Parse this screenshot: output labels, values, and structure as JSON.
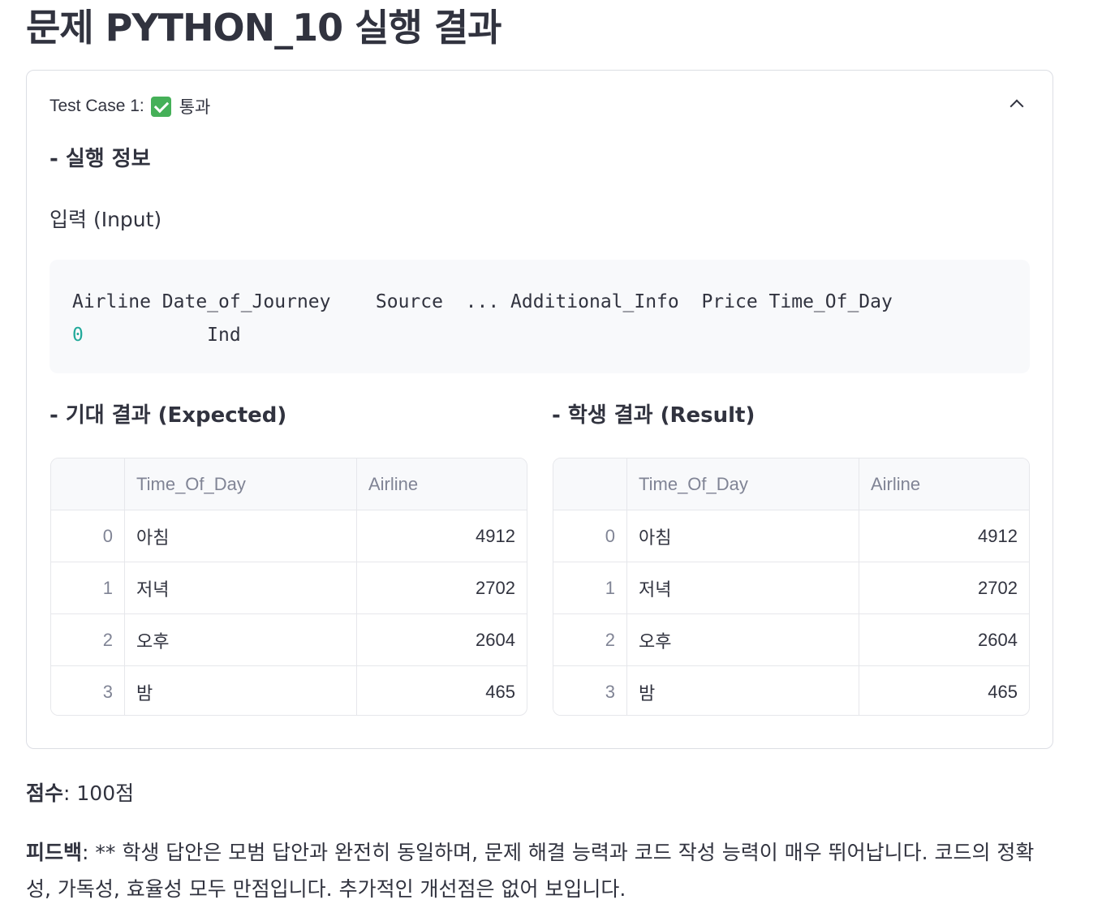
{
  "page": {
    "title": "문제 PYTHON_10 실행 결과"
  },
  "expander": {
    "header_prefix": "Test Case 1:",
    "status_icon": "check-mark-icon",
    "status_label": "통과",
    "toggle_icon": "chevron-up-icon",
    "exec_info_title": "- 실행 정보",
    "input_label": "입력 (Input)",
    "code_line1": "Airline Date_of_Journey    Source  ... Additional_Info  Price Time_Of_Day",
    "code_line2_index": "0",
    "code_line2_rest": "           Ind",
    "expected_title": "- 기대 결과 (Expected)",
    "result_title": "- 학생 결과 (Result)"
  },
  "expected_table": {
    "columns": [
      "",
      "Time_Of_Day",
      "Airline"
    ],
    "rows": [
      {
        "index": "0",
        "time_of_day": "아침",
        "airline": "4912"
      },
      {
        "index": "1",
        "time_of_day": "저녁",
        "airline": "2702"
      },
      {
        "index": "2",
        "time_of_day": "오후",
        "airline": "2604"
      },
      {
        "index": "3",
        "time_of_day": "밤",
        "airline": "465"
      }
    ]
  },
  "result_table": {
    "columns": [
      "",
      "Time_Of_Day",
      "Airline"
    ],
    "rows": [
      {
        "index": "0",
        "time_of_day": "아침",
        "airline": "4912"
      },
      {
        "index": "1",
        "time_of_day": "저녁",
        "airline": "2702"
      },
      {
        "index": "2",
        "time_of_day": "오후",
        "airline": "2604"
      },
      {
        "index": "3",
        "time_of_day": "밤",
        "airline": "465"
      }
    ]
  },
  "score": {
    "label": "점수",
    "value": ": 100점"
  },
  "feedback": {
    "label": "피드백",
    "text": ": ** 학생 답안은 모범 답안과 완전히 동일하며, 문제 해결 능력과 코드 작성 능력이 매우 뛰어납니다. 코드의 정확성, 가독성, 효율성 모두 만점입니다. 추가적인 개선점은 없어 보입니다."
  },
  "colors": {
    "text": "#31333f",
    "muted": "#808495",
    "border": "#e6e7eb",
    "code_bg": "#f8f9fb",
    "success": "#45b058"
  }
}
